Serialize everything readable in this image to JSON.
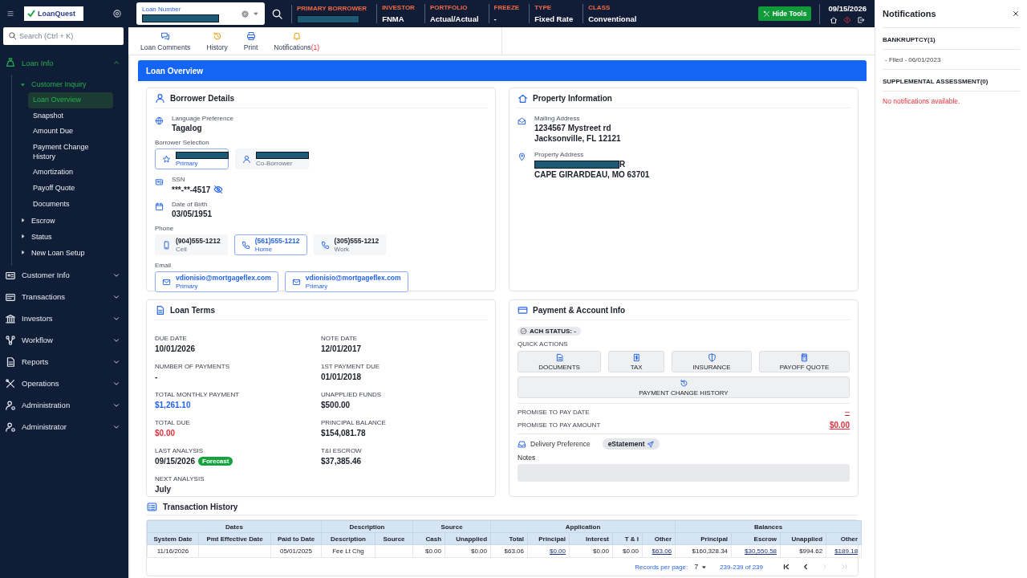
{
  "sidebar": {
    "logo": "LoanQuest",
    "search": {
      "placeholder": "Search (Ctrl + K)"
    },
    "items": [
      {
        "label": "Loan Info",
        "expanded": true,
        "children": [
          {
            "label": "Customer Inquiry",
            "expanded": true,
            "children": [
              {
                "label": "Loan Overview",
                "selected": true
              },
              {
                "label": "Snapshot",
                "selected": false
              },
              {
                "label": "Amount Due",
                "selected": false
              },
              {
                "label": "Payment Change History",
                "selected": false
              },
              {
                "label": "Amortization",
                "selected": false
              },
              {
                "label": "Payoff Quote",
                "selected": false
              },
              {
                "label": "Documents",
                "selected": false
              }
            ]
          },
          {
            "label": "Escrow",
            "expanded": false
          },
          {
            "label": "Status",
            "expanded": false
          },
          {
            "label": "New Loan Setup",
            "expanded": false
          }
        ]
      },
      {
        "label": "Customer Info",
        "expanded": false
      },
      {
        "label": "Transactions",
        "expanded": false
      },
      {
        "label": "Investors",
        "expanded": false
      },
      {
        "label": "Workflow",
        "expanded": false
      },
      {
        "label": "Reports",
        "expanded": false
      },
      {
        "label": "Operations",
        "expanded": false
      },
      {
        "label": "Administration",
        "expanded": false
      },
      {
        "label": "Administrator",
        "expanded": false
      }
    ]
  },
  "header": {
    "loan_number": {
      "label": "Loan Number",
      "redacted": true
    },
    "fields": [
      {
        "label": "PRIMARY BORROWER",
        "redacted": true
      },
      {
        "label": "INVESTOR",
        "value": "FNMA"
      },
      {
        "label": "PORTFOLIO",
        "value": "Actual/Actual"
      },
      {
        "label": "FREEZE",
        "value": "-"
      },
      {
        "label": "TYPE",
        "value": "Fixed Rate"
      },
      {
        "label": "CLASS",
        "value": "Conventional"
      }
    ],
    "hide_tools": "Hide Tools",
    "date": "09/15/2026"
  },
  "toolbar": [
    {
      "label": "Loan Comments"
    },
    {
      "label": "History"
    },
    {
      "label": "Print"
    },
    {
      "label": "Notifications",
      "count": "(1)"
    }
  ],
  "page_title": "Loan Overview",
  "borrower_details": {
    "title": "Borrower Details",
    "language": {
      "label": "Language Preference",
      "value": "Tagalog"
    },
    "selection": {
      "label": "Borrower Selection",
      "options": [
        {
          "role": "Primary",
          "redacted": true,
          "selected": true
        },
        {
          "role": "Co-Borrower",
          "redacted": true,
          "selected": false
        }
      ]
    },
    "ssn": {
      "label": "SSN",
      "value": "***-**-4517"
    },
    "dob": {
      "label": "Date of Birth",
      "value": "03/05/1951"
    },
    "phone": {
      "label": "Phone",
      "options": [
        {
          "number": "(904)555-1212",
          "type": "Cell",
          "selected": false
        },
        {
          "number": "(561)555-1212",
          "type": "Home",
          "selected": true
        },
        {
          "number": "(305)555-1212",
          "type": "Work",
          "selected": false
        }
      ]
    },
    "email": {
      "label": "Email",
      "options": [
        {
          "address": "vdionisio@mortgageflex.com",
          "type": "Primary"
        },
        {
          "address": "vdionisio@mortgageflex.com",
          "type": "Primary"
        }
      ]
    }
  },
  "property_information": {
    "title": "Property Information",
    "mailing": {
      "label": "Mailing Address",
      "lines": [
        {
          "text": "1234567 Mystreet rd",
          "redacted": false
        },
        {
          "text": "Jacksonville, FL 12121",
          "redacted": false
        }
      ]
    },
    "property": {
      "label": "Property Address",
      "lines": [
        {
          "text": "R",
          "redacted": true
        },
        {
          "text": "CAPE GIRARDEAU, MO 63701",
          "redacted": false
        }
      ]
    }
  },
  "loan_terms": {
    "title": "Loan Terms",
    "fields": [
      {
        "label": "DUE DATE",
        "value": "10/01/2026",
        "kind": "plain"
      },
      {
        "label": "NOTE DATE",
        "value": "12/01/2017",
        "kind": "plain"
      },
      {
        "label": "NUMBER OF PAYMENTS",
        "value": "-",
        "kind": "plain"
      },
      {
        "label": "1ST PAYMENT DUE",
        "value": "01/01/2018",
        "kind": "plain"
      },
      {
        "label": "TOTAL MONTHLY PAYMENT",
        "value": "$1,261.10",
        "kind": "link"
      },
      {
        "label": "UNAPPLIED FUNDS",
        "value": "$500.00",
        "kind": "plain"
      },
      {
        "label": "TOTAL DUE",
        "value": "$0.00",
        "kind": "alert"
      },
      {
        "label": "PRINCIPAL BALANCE",
        "value": "$154,081.78",
        "kind": "plain"
      },
      {
        "label": "LAST ANALYSIS",
        "value": "09/15/2026",
        "kind": "plain",
        "badge": "Forecast"
      },
      {
        "label": "T&I ESCROW",
        "value": "$37,385.46",
        "kind": "plain"
      },
      {
        "label": "NEXT ANALYSIS",
        "value": "July",
        "kind": "plain"
      }
    ]
  },
  "payment_account": {
    "title": "Payment & Account Info",
    "ach_status": "ACH STATUS: -",
    "quick_actions": {
      "label": "QUICK ACTIONS",
      "buttons": [
        "DOCUMENTS",
        "TAX",
        "INSURANCE",
        "PAYOFF QUOTE"
      ],
      "wide_button": "PAYMENT CHANGE HISTORY"
    },
    "promises": [
      {
        "label": "PROMISE TO PAY DATE",
        "value": "--"
      },
      {
        "label": "PROMISE TO PAY AMOUNT",
        "value": "$0.00"
      }
    ],
    "delivery": {
      "label": "Delivery Preference",
      "value": "eStatement"
    },
    "notes": {
      "label": "Notes"
    }
  },
  "transaction_history": {
    "title": "Transaction History",
    "groups": [
      {
        "label": "Dates",
        "columns": [
          "System Date",
          "Pmt Effective Date",
          "Paid to Date"
        ]
      },
      {
        "label": "Description",
        "columns": [
          "Description",
          "Source"
        ]
      },
      {
        "label": "Source",
        "columns": [
          "Cash",
          "Unapplied"
        ]
      },
      {
        "label": "Application",
        "columns": [
          "Total",
          "Principal",
          "Interest",
          "T & I",
          "Other"
        ]
      },
      {
        "label": "Balances",
        "columns": [
          "Principal",
          "Escrow",
          "Unapplied",
          "Other"
        ]
      }
    ],
    "rows": [
      {
        "cells": [
          {
            "text": "11/16/2026",
            "link": false
          },
          null,
          {
            "text": "05/01/2025",
            "link": false
          },
          {
            "text": "Fee Lt Chg",
            "link": false
          },
          null,
          {
            "text": "$0.00",
            "link": false
          },
          {
            "text": "$0.00",
            "link": false
          },
          {
            "text": "$63.06",
            "link": false
          },
          {
            "text": "$0.00",
            "link": true
          },
          {
            "text": "$0.00",
            "link": false
          },
          {
            "text": "$0.00",
            "link": false
          },
          {
            "text": "$63.06",
            "link": true
          },
          {
            "text": "$160,328.34",
            "link": false
          },
          {
            "text": "$30,550.58",
            "link": true
          },
          {
            "text": "$994.62",
            "link": false
          },
          {
            "text": "$189.18",
            "link": true
          }
        ]
      }
    ],
    "pagination": {
      "label": "Records per page:",
      "per_page": "7",
      "range": "239-239 of 239",
      "buttons": [
        {
          "kind": "first",
          "disabled": false
        },
        {
          "kind": "previous",
          "disabled": false
        },
        {
          "kind": "next",
          "disabled": true
        },
        {
          "kind": "last",
          "disabled": true
        }
      ]
    }
  },
  "notifications": {
    "title": "Notifications",
    "sections": [
      {
        "title": "BANKRUPTCY(1)",
        "items": [
          "- Filed - 06/01/2023"
        ]
      },
      {
        "title": "SUPPLEMENTAL ASSESSMENT(0)",
        "empty_message": "No notifications available."
      }
    ]
  }
}
